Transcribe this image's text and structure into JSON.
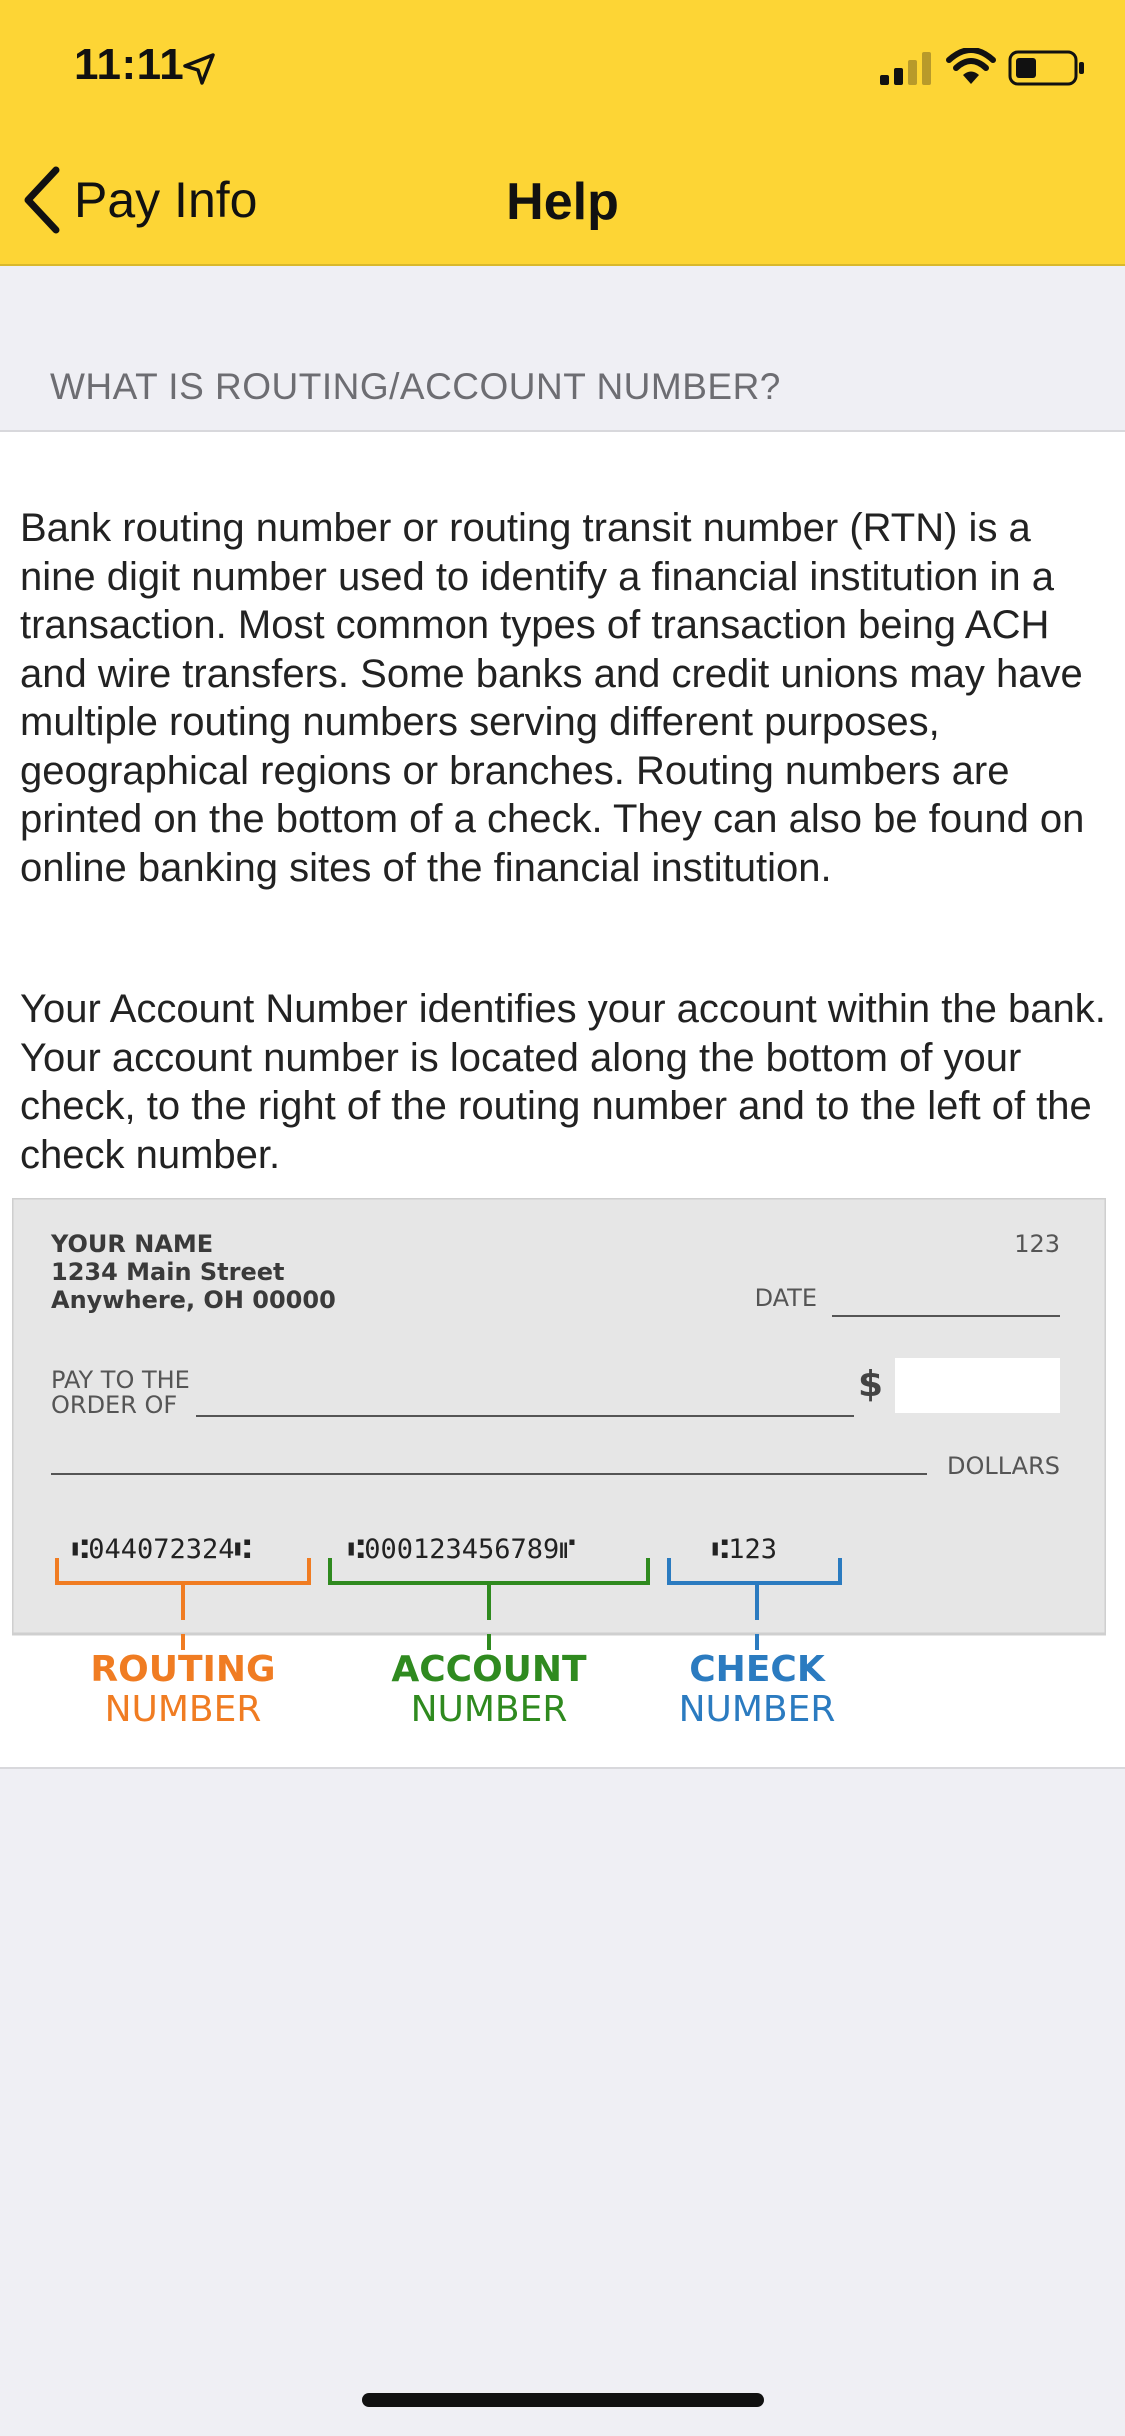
{
  "status_bar": {
    "time": "11:11",
    "icons": [
      "location-arrow-icon",
      "cellular-signal-icon",
      "wifi-icon",
      "battery-icon"
    ]
  },
  "nav": {
    "back_label": "Pay Info",
    "title": "Help"
  },
  "section": {
    "header": "WHAT IS ROUTING/ACCOUNT NUMBER?"
  },
  "content": {
    "paragraph_1": "Bank routing number or routing transit number (RTN) is a nine digit number used to identify a financial institution in a transaction. Most common types of transaction being ACH and wire transfers. Some banks and credit unions may have multiple routing numbers serving different purposes, geographical regions or branches. Routing numbers are printed on the bottom of a check. They can also be found on online banking sites of the financial institution.",
    "paragraph_2": "Your Account Number identifies your account within the bank. Your account number is located along the bottom of your check, to the right of the routing number and to the left of the check number."
  },
  "check": {
    "name": "YOUR NAME",
    "street": "1234 Main Street",
    "city": "Anywhere, OH 00000",
    "check_no": "123",
    "date_label": "DATE",
    "pay_to_line1": "PAY TO THE",
    "pay_to_line2": "ORDER OF",
    "dollar_sign": "$",
    "dollars_label": "DOLLARS",
    "micr_routing": "⑆044072324⑆",
    "micr_account": "⑆000123456789⑈",
    "micr_check": "⑆123",
    "labels": {
      "routing_1": "ROUTING",
      "routing_2": "NUMBER",
      "account_1": "ACCOUNT",
      "account_2": "NUMBER",
      "check_1": "CHECK",
      "check_2": "NUMBER"
    },
    "colors": {
      "routing": "#f07c22",
      "account": "#2f8a1f",
      "check": "#2b7bc0",
      "paper": "#e6e6e6"
    }
  }
}
